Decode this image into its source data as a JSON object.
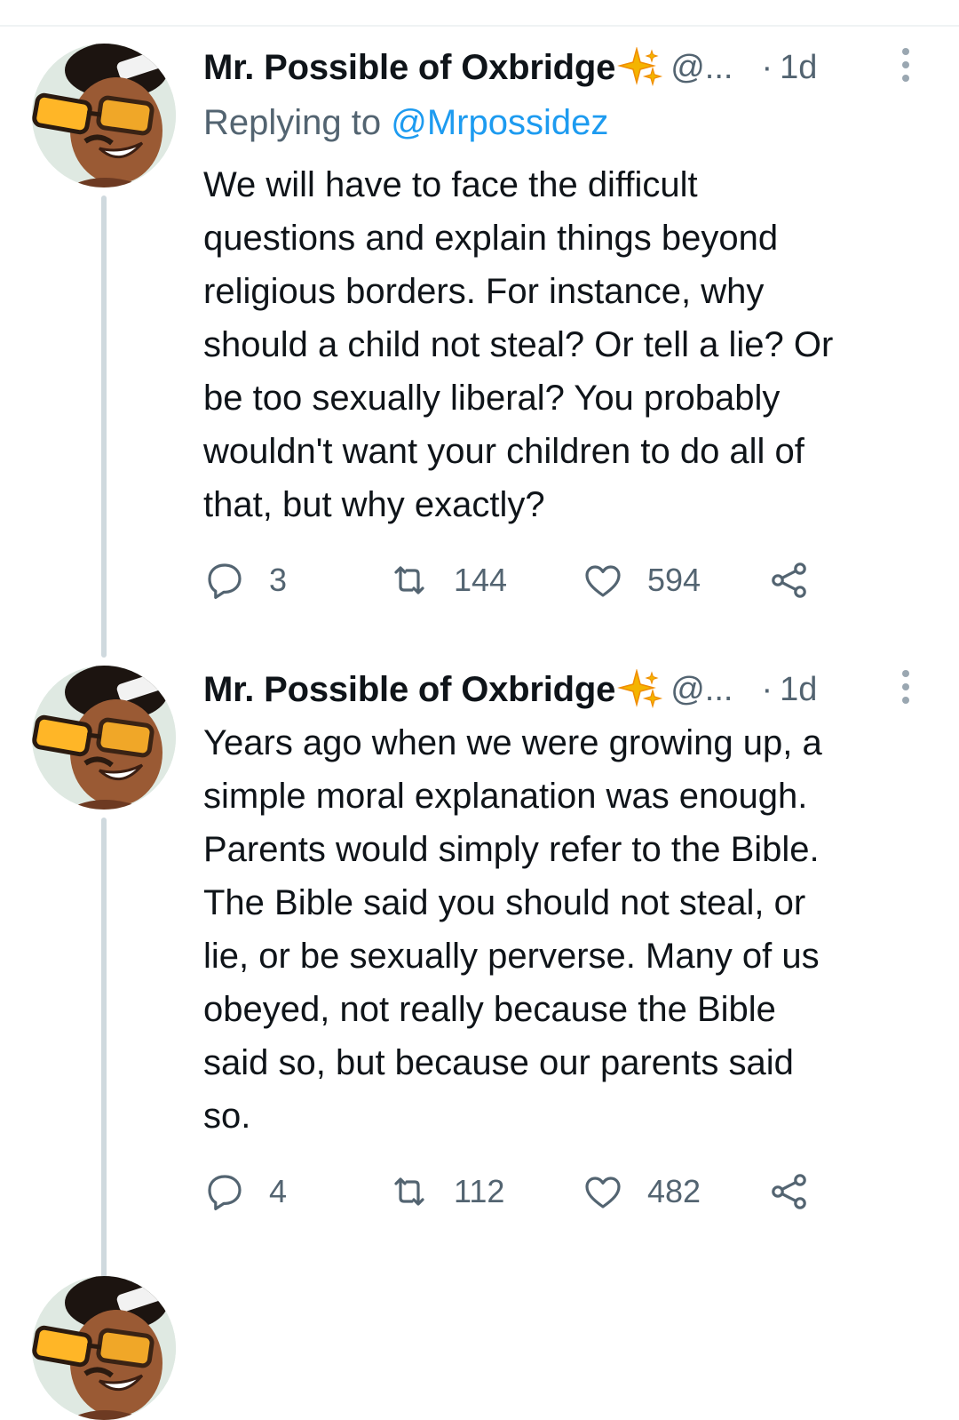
{
  "colors": {
    "text_primary": "#0f1419",
    "text_secondary": "#536471",
    "link": "#1d9bf0",
    "thread_line": "#cfd9de",
    "sparkle": "#f4b400"
  },
  "tweets": [
    {
      "author_name": "Mr. Possible of Oxbridge",
      "badge_icon": "sparkle-emoji",
      "handle": "@...",
      "dot": "·",
      "time": "1d",
      "replying_prefix": "Replying to ",
      "replying_to": "@Mrpossidez",
      "body_lines": [
        "We will have to face the difficult",
        "questions and explain things beyond",
        "religious borders. For instance, why",
        "should a child not steal? Or tell a lie? Or",
        "be too sexually liberal? You probably",
        "wouldn't want your children to do all of",
        "that, but why exactly?"
      ],
      "replies": "3",
      "retweets": "144",
      "likes": "594"
    },
    {
      "author_name": "Mr. Possible of Oxbridge",
      "badge_icon": "sparkle-emoji",
      "handle": "@...",
      "dot": "·",
      "time": "1d",
      "body_lines": [
        "Years ago when we were growing up, a",
        "simple moral explanation was enough.",
        "Parents would simply refer to the Bible.",
        "The Bible said you should not steal, or",
        "lie, or be sexually perverse. Many of us",
        "obeyed, not really because the Bible",
        "said so, but because our parents said",
        "so."
      ],
      "replies": "4",
      "retweets": "112",
      "likes": "482"
    }
  ]
}
